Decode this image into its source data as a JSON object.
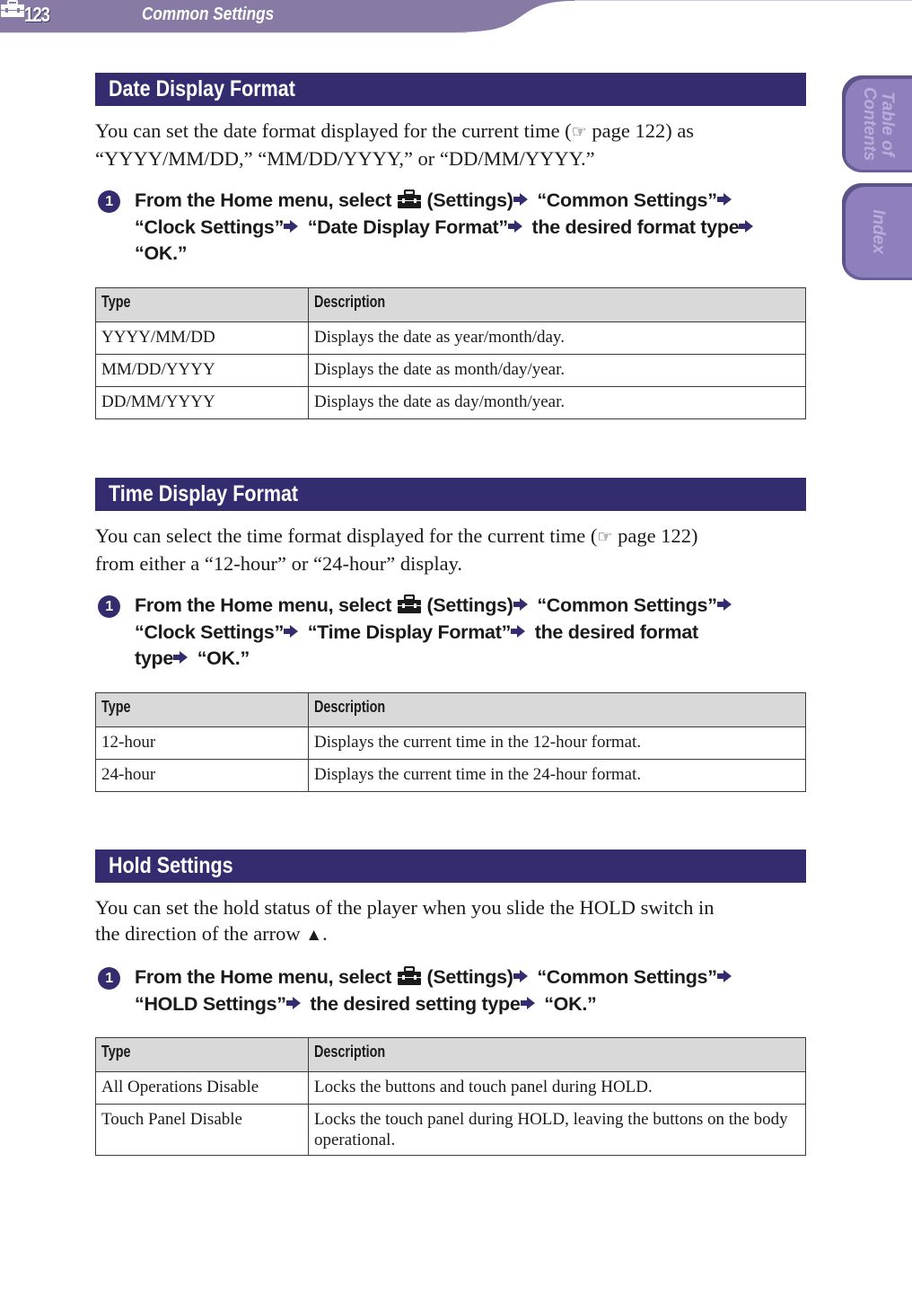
{
  "header": {
    "page_number": "123",
    "section_icon": "toolbox-icon",
    "section_title": "Common Settings",
    "colors": {
      "band": "#877ba5",
      "section_head": "#332c6f",
      "tab": "#8f80bd",
      "table_header": "#d9d9d9"
    }
  },
  "side_tabs": {
    "table_of_contents": "Table of\nContents",
    "index": "Index"
  },
  "sections": [
    {
      "title": "Date Display Format",
      "intro_before_ref": "You can set the date format displayed for the current time (",
      "ref_icon": "pointing-hand-icon",
      "intro_ref": " page 122) as",
      "intro_after_ref": "“YYYY/MM/DD,” “MM/DD/YYYY,” or “DD/MM/YYYY.”",
      "step_number": "1",
      "step_parts": [
        "From the Home menu, select",
        "(Settings)",
        "“Common Settings”",
        "“Clock Settings”",
        "“Date Display Format”",
        "the desired format type",
        "“OK.”"
      ],
      "table": {
        "headers": [
          "Type",
          "Description"
        ],
        "rows": [
          [
            "YYYY/MM/DD",
            "Displays the date as year/month/day."
          ],
          [
            "MM/DD/YYYY",
            "Displays the date as month/day/year."
          ],
          [
            "DD/MM/YYYY",
            "Displays the date as day/month/year."
          ]
        ]
      }
    },
    {
      "title": "Time Display Format",
      "intro_before_ref": "You can select the time format displayed for the current time (",
      "ref_icon": "pointing-hand-icon",
      "intro_ref": " page 122)",
      "intro_after_ref": "from either a “12-hour” or “24-hour” display.",
      "step_number": "1",
      "step_parts": [
        "From the Home menu, select",
        "(Settings)",
        "“Common Settings”",
        "“Clock Settings”",
        "“Time Display Format”",
        "the desired format",
        "type",
        "“OK.”"
      ],
      "table": {
        "headers": [
          "Type",
          "Description"
        ],
        "rows": [
          [
            "12-hour",
            "Displays the current time in the 12-hour format."
          ],
          [
            "24-hour",
            "Displays the current time in the 24-hour format."
          ]
        ]
      }
    },
    {
      "title": "Hold Settings",
      "intro_line1": "You can set the hold status of the player when you slide the HOLD switch in",
      "intro_line2": "the direction of the arrow ",
      "intro_arrow": "▲",
      "intro_end": ".",
      "step_number": "1",
      "step_parts": [
        "From the Home menu, select",
        "(Settings)",
        "“Common Settings”",
        "“HOLD Settings”",
        "the desired setting type",
        "“OK.”"
      ],
      "table": {
        "headers": [
          "Type",
          "Description"
        ],
        "rows": [
          [
            "All Operations Disable",
            "Locks the buttons and touch panel during HOLD."
          ],
          [
            "Touch Panel Disable",
            "Locks the touch panel during HOLD, leaving the buttons on the body operational."
          ]
        ]
      }
    }
  ]
}
